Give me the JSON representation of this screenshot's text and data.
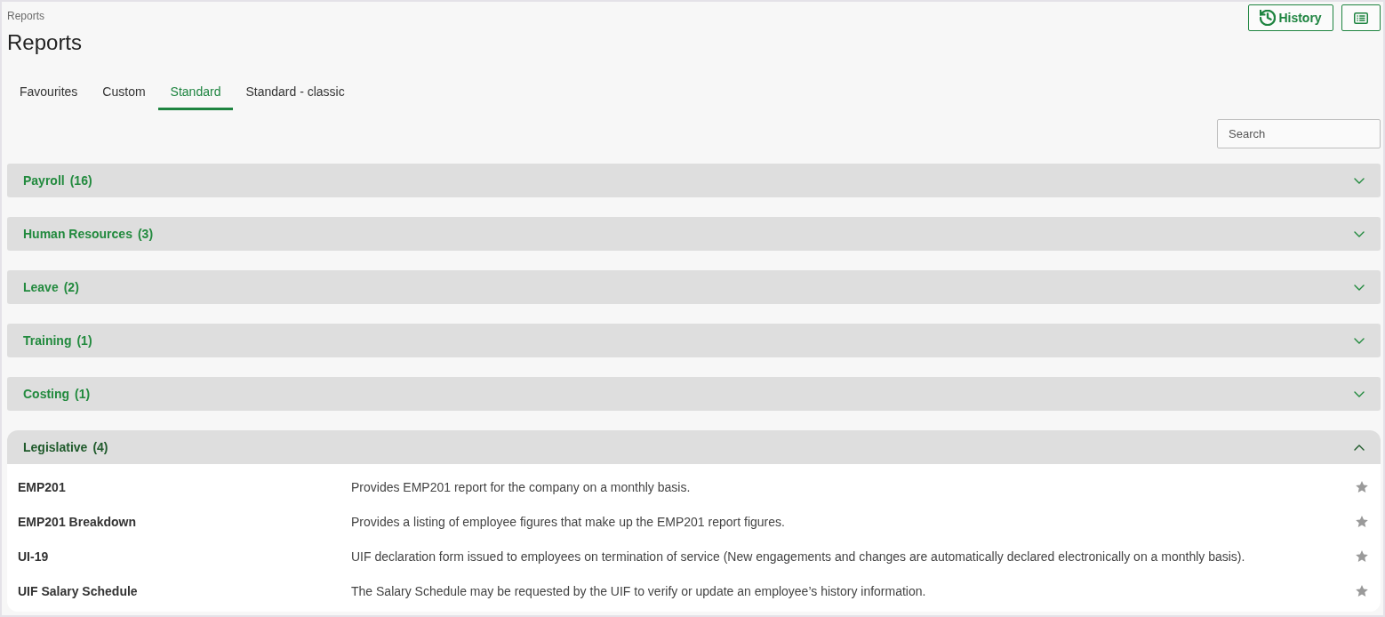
{
  "breadcrumb": "Reports",
  "title": "Reports",
  "toolbar": {
    "history_button": "History"
  },
  "tabs": [
    {
      "label": "Favourites",
      "selected": false
    },
    {
      "label": "Custom",
      "selected": false
    },
    {
      "label": "Standard",
      "selected": true
    },
    {
      "label": "Standard - classic",
      "selected": false
    }
  ],
  "search": {
    "placeholder": "Search"
  },
  "sections": [
    {
      "name": "Payroll",
      "count": "(16)",
      "expanded": false
    },
    {
      "name": "Human Resources",
      "count": "(3)",
      "expanded": false
    },
    {
      "name": "Leave",
      "count": "(2)",
      "expanded": false
    },
    {
      "name": "Training",
      "count": "(1)",
      "expanded": false
    },
    {
      "name": "Costing",
      "count": "(1)",
      "expanded": false
    },
    {
      "name": "Legislative",
      "count": "(4)",
      "expanded": true,
      "reports": [
        {
          "name": "EMP201",
          "description": "Provides EMP201 report for the company on a monthly basis.",
          "favourite": false
        },
        {
          "name": "EMP201 Breakdown",
          "description": "Provides a listing of employee figures that make up the EMP201 report figures.",
          "favourite": false
        },
        {
          "name": "UI-19",
          "description": "UIF declaration form issued to employees on termination of service (New engagements and changes are automatically declared electronically on a monthly basis).",
          "favourite": false
        },
        {
          "name": "UIF Salary Schedule",
          "description": "The Salary Schedule may be requested by the UIF to verify or update an employee’s history information.",
          "favourite": false
        }
      ]
    }
  ]
}
